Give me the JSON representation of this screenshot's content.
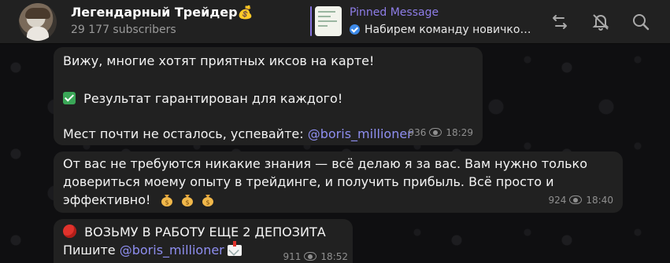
{
  "header": {
    "channel_title": "Легендарный Трейдер💰",
    "subscribers": "29 177 subscribers",
    "pinned_title": "Pinned Message",
    "pinned_text": "Набирем команду новичко…"
  },
  "icons": {
    "avatar": "channel-avatar",
    "pin_verified": "verified-check-icon",
    "actions": [
      "change-link-icon",
      "mute-bell-icon",
      "search-icon"
    ]
  },
  "messages": [
    {
      "lines": [
        "Вижу, многие хотят приятных иксов на карте!",
        "Результат гарантирован для каждого!",
        "Мест почти не осталось, успевайте:",
        "@boris_millioner"
      ],
      "views": "936",
      "time": "18:29"
    },
    {
      "lines": [
        "От вас не требуются никакие знания — всё делаю я за вас. Вам нужно только",
        "довериться моему опыту в трейдинге, и получить прибыль. Всё просто и",
        "эффективно!"
      ],
      "views": "924",
      "time": "18:40"
    },
    {
      "lines": [
        "ВОЗЬМУ В РАБОТУ ЕЩЕ 2 ДЕПОЗИТА",
        "Пишите",
        "@boris_millioner"
      ],
      "views": "911",
      "time": "18:52"
    }
  ],
  "colors": {
    "header_bg": "#212121",
    "chat_bg": "#0f0f11",
    "bubble_bg": "#212121",
    "accent": "#8e7de8",
    "mention": "#8e8ef0"
  }
}
